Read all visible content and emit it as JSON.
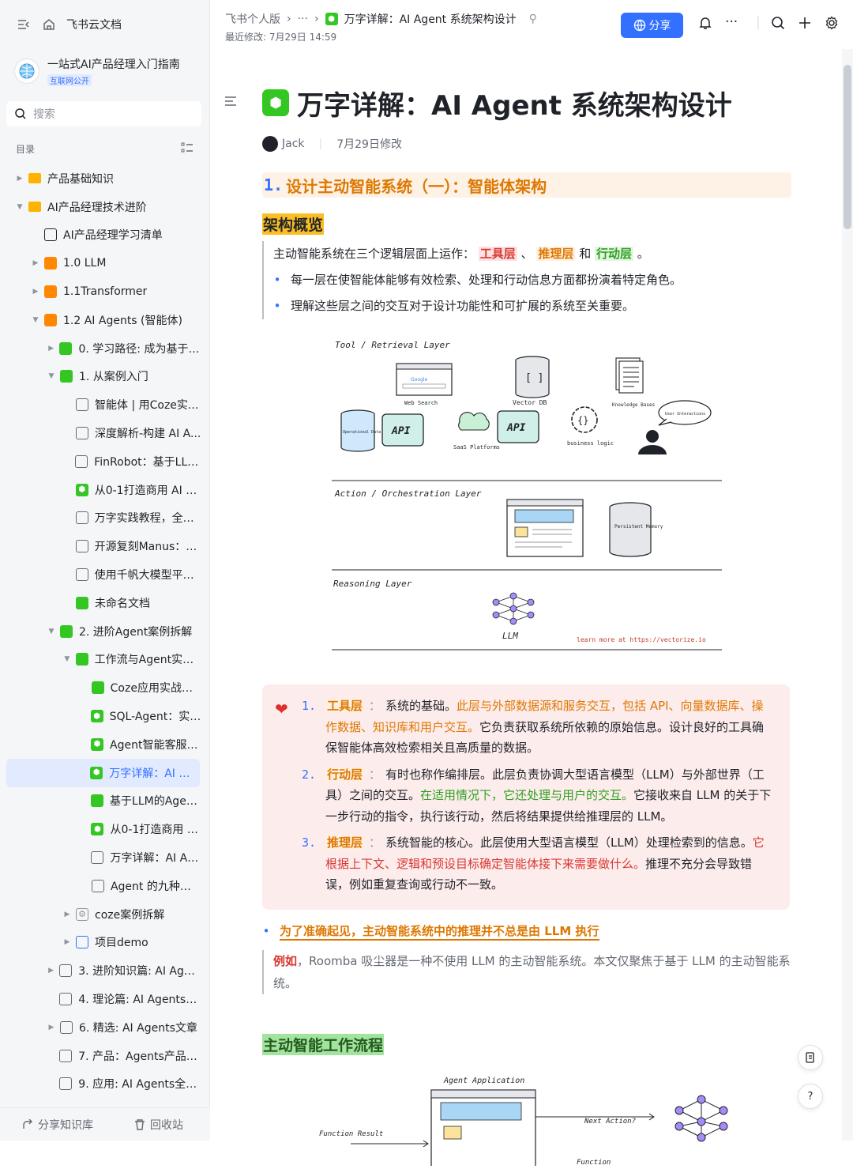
{
  "sidebar": {
    "home_label": "飞书云文档",
    "kb_title": "一站式AI产品经理入门指南",
    "kb_badge": "互联网公开",
    "search_placeholder": "搜索",
    "toc_label": "目录",
    "items": [
      {
        "label": "产品基础知识",
        "indent": 0,
        "arrow": "right",
        "icon": "folder-icon",
        "color": "#ffb300"
      },
      {
        "label": "AI产品经理技术进阶",
        "indent": 0,
        "arrow": "down",
        "icon": "folder-icon",
        "color": "#ffb300"
      },
      {
        "label": "AI产品经理学习清单",
        "indent": 1,
        "arrow": "none",
        "icon": "save-icon",
        "color": "#1f2329"
      },
      {
        "label": "1.0 LLM",
        "indent": 1,
        "arrow": "right",
        "icon": "doc-icon",
        "color": "#ff8800"
      },
      {
        "label": "1.1Transformer",
        "indent": 1,
        "arrow": "right",
        "icon": "doc-icon",
        "color": "#ff8800"
      },
      {
        "label": "1.2 AI Agents (智能体)",
        "indent": 1,
        "arrow": "down",
        "icon": "doc-icon",
        "color": "#ff8800"
      },
      {
        "label": "0. 学习路径: 成为基于A...",
        "indent": 2,
        "arrow": "right",
        "icon": "doc-icon",
        "color": "#34c724"
      },
      {
        "label": "1. 从案例入门",
        "indent": 2,
        "arrow": "down",
        "icon": "doc-icon",
        "color": "#34c724"
      },
      {
        "label": "智能体 | 用Coze实...",
        "indent": 3,
        "arrow": "none",
        "icon": "page-icon",
        "color": "#646a73"
      },
      {
        "label": "深度解析-构建 AI A...",
        "indent": 3,
        "arrow": "none",
        "icon": "page-icon",
        "color": "#646a73"
      },
      {
        "label": "FinRobot：基于LLM...",
        "indent": 3,
        "arrow": "none",
        "icon": "page-icon",
        "color": "#646a73"
      },
      {
        "label": "从0-1打造商用 AI A...",
        "indent": 3,
        "arrow": "none",
        "icon": "cube-icon",
        "color": "#34c724"
      },
      {
        "label": "万字实践教程，全面...",
        "indent": 3,
        "arrow": "none",
        "icon": "page-icon",
        "color": "#646a73"
      },
      {
        "label": "开源复刻Manus：O...",
        "indent": 3,
        "arrow": "none",
        "icon": "page-icon",
        "color": "#646a73"
      },
      {
        "label": "使用千帆大模型平台...",
        "indent": 3,
        "arrow": "none",
        "icon": "page-icon",
        "color": "#646a73"
      },
      {
        "label": "未命名文档",
        "indent": 3,
        "arrow": "none",
        "icon": "doc-icon",
        "color": "#34c724"
      },
      {
        "label": "2. 进阶Agent案例拆解",
        "indent": 2,
        "arrow": "down",
        "icon": "doc-icon",
        "color": "#34c724"
      },
      {
        "label": "工作流与Agent实战...",
        "indent": 3,
        "arrow": "down",
        "icon": "doc-icon",
        "color": "#34c724"
      },
      {
        "label": "Coze应用实战指南",
        "indent": 4,
        "arrow": "none",
        "icon": "doc-icon",
        "color": "#34c724"
      },
      {
        "label": "SQL-Agent：实现...",
        "indent": 4,
        "arrow": "none",
        "icon": "cube-icon",
        "color": "#34c724"
      },
      {
        "label": "Agent智能客服，...",
        "indent": 4,
        "arrow": "none",
        "icon": "cube-icon",
        "color": "#34c724"
      },
      {
        "label": "万字详解：AI Ag...",
        "indent": 4,
        "arrow": "none",
        "icon": "cube-icon",
        "color": "#34c724",
        "active": true
      },
      {
        "label": "基于LLM的Agent...",
        "indent": 4,
        "arrow": "none",
        "icon": "doc-icon",
        "color": "#34c724"
      },
      {
        "label": "从0-1打造商用 A...",
        "indent": 4,
        "arrow": "none",
        "icon": "cube-icon",
        "color": "#34c724"
      },
      {
        "label": "万字详解：AI Ag...",
        "indent": 4,
        "arrow": "none",
        "icon": "pdf-icon",
        "color": "#646a73"
      },
      {
        "label": "Agent 的九种设...",
        "indent": 4,
        "arrow": "none",
        "icon": "page-icon",
        "color": "#646a73"
      },
      {
        "label": "coze案例拆解",
        "indent": 3,
        "arrow": "right",
        "icon": "gear-icon",
        "color": "#8f959e"
      },
      {
        "label": "项目demo",
        "indent": 3,
        "arrow": "right",
        "icon": "stack-icon",
        "color": "#3370ff"
      },
      {
        "label": "3. 进阶知识篇: AI Agen...",
        "indent": 2,
        "arrow": "right",
        "icon": "page-icon",
        "color": "#646a73"
      },
      {
        "label": "4. 理论篇: AI Agents理...",
        "indent": 2,
        "arrow": "none",
        "icon": "box-icon",
        "color": "#646a73"
      },
      {
        "label": "6. 精选: AI Agents文章",
        "indent": 2,
        "arrow": "right",
        "icon": "box-icon",
        "color": "#646a73"
      },
      {
        "label": "7. 产品：Agents产品分析",
        "indent": 2,
        "arrow": "none",
        "icon": "box-icon",
        "color": "#646a73"
      },
      {
        "label": "9. 应用: AI Agents全景图",
        "indent": 2,
        "arrow": "none",
        "icon": "box-icon",
        "color": "#646a73"
      }
    ],
    "share_kb_label": "分享知识库",
    "recycle_label": "回收站"
  },
  "header": {
    "crumb_root": "飞书个人版",
    "crumb_more": "···",
    "crumb_current": "万字详解：AI Agent 系统架构设计",
    "modified": "最近修改: 7月29日 14:59",
    "share_label": "分享"
  },
  "doc": {
    "title": "万字详解：AI Agent 系统架构设计",
    "author": "Jack",
    "edited": "7月29日修改",
    "h1_num": "1.",
    "h1_text": "设计主动智能系统（一）：智能体架构",
    "h2_overview": "架构概览",
    "intro_prefix": "主动智能系统在三个逻辑层面上运作：",
    "layer_tool": "工具层",
    "sep1": "、",
    "layer_reason": "推理层",
    "and": "和",
    "layer_action": "行动层",
    "end": "。",
    "bullets": [
      "每一层在使智能体能够有效检索、处理和行动信息方面都扮演着特定角色。",
      "理解这些层之间的交互对于设计功能性和可扩展的系统至关重要。"
    ],
    "diagram": {
      "tool_layer": "Tool / Retrieval Layer",
      "action_layer": "Action / Orchestration Layer",
      "reasoning_layer": "Reasoning Layer",
      "web_search": "Web Search",
      "vector_db": "Vector DB",
      "knowledge_bases": "Knowledge Bases",
      "user_interactions": "User Interactions",
      "operational_data": "Operational Data",
      "api": "API",
      "saas": "SaaS Platforms",
      "business_logic": "business logic",
      "persistent_memory": "Persistent Memory",
      "llm": "LLM",
      "learn_more": "learn more at https://vectorize.io",
      "google": "Google"
    },
    "callout": [
      {
        "num": "1.",
        "key": "工具层",
        "parts": [
          {
            "t": "系统的基础。",
            "c": ""
          },
          {
            "t": "此层与外部数据源和服务交互，包括 API、向量数据库、操作数据、知识库和用户交互。",
            "c": "orange"
          },
          {
            "t": "它负责获取系统所依赖的原始信息。设计良好的工具确保智能体高效检索相关且高质量的数据。",
            "c": ""
          }
        ]
      },
      {
        "num": "2.",
        "key": "行动层",
        "parts": [
          {
            "t": "有时也称作编排层。此层负责协调大型语言模型（LLM）与外部世界（工具）之间的交互。",
            "c": ""
          },
          {
            "t": "在适用情况下，它还处理与用户的交互。",
            "c": "green"
          },
          {
            "t": "它接收来自 LLM 的关于下一步行动的指令，执行该行动，然后将结果提供给推理层的 LLM。",
            "c": ""
          }
        ]
      },
      {
        "num": "3.",
        "key": "推理层",
        "parts": [
          {
            "t": "系统智能的核心。此层使用大型语言模型（LLM）处理检索到的信息。",
            "c": ""
          },
          {
            "t": "它根据上下文、逻辑和预设目标确定智能体接下来需要做什么。",
            "c": "red"
          },
          {
            "t": "推理不充分会导致错误，例如重复查询或行动不一致。",
            "c": ""
          }
        ]
      }
    ],
    "note": "为了准确起见，主动智能系统中的推理并不总是由 LLM 执行",
    "example_key": "例如",
    "example_text": "，Roomba 吸尘器是一种不使用 LLM 的主动智能系统。本文仅聚焦于基于 LLM 的主动智能系统。",
    "h2_workflow": "主动智能工作流程",
    "diagram2": {
      "agent_app": "Agent Application",
      "function_result": "Function Result",
      "next_action": "Next Action?",
      "function": "Function"
    }
  }
}
